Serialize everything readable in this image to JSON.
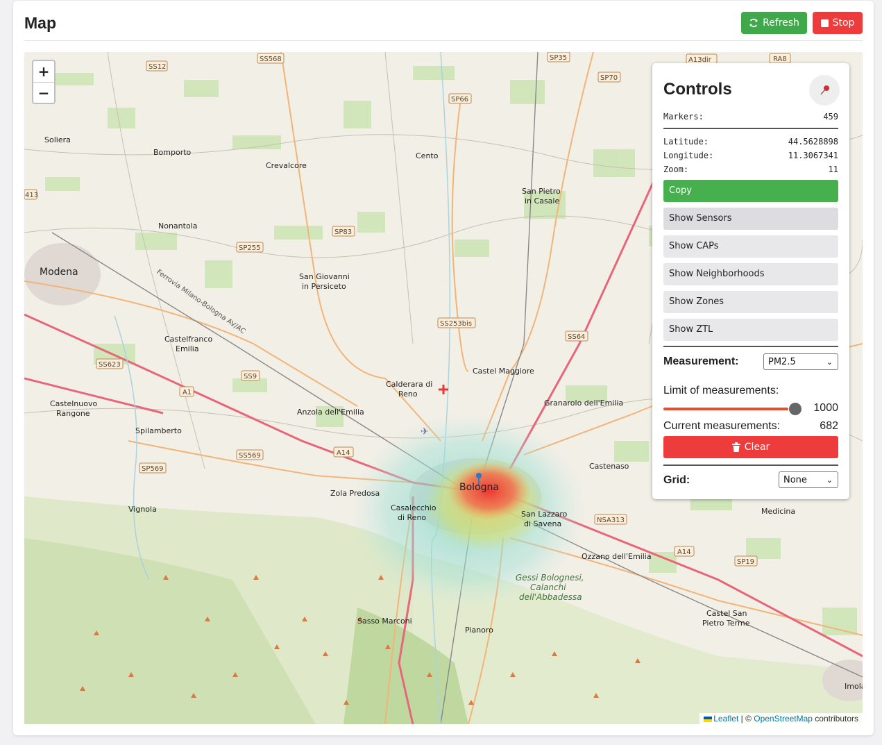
{
  "header": {
    "title": "Map",
    "refresh_label": "Refresh",
    "stop_label": "Stop"
  },
  "map": {
    "zoom_in": "+",
    "zoom_out": "−",
    "attribution": {
      "leaflet": "Leaflet",
      "separator": " | © ",
      "osm": "OpenStreetMap",
      "suffix": " contributors"
    },
    "places": {
      "soliera": "Soliera",
      "bomporto": "Bomporto",
      "crevalcore": "Crevalcore",
      "cento": "Cento",
      "san_pietro_1": "San Pietro",
      "san_pietro_2": "in Casale",
      "nonantola": "Nonantola",
      "modena": "Modena",
      "san_giovanni_1": "San Giovanni",
      "san_giovanni_2": "in Persiceto",
      "castelfranco_1": "Castelfranco",
      "castelfranco_2": "Emilia",
      "calderara_1": "Calderara di",
      "calderara_2": "Reno",
      "castel_maggiore": "Castel Maggiore",
      "granarolo": "Granarolo dell'Emilia",
      "castelnuovo_1": "Castelnuovo",
      "castelnuovo_2": "Rangone",
      "anzola": "Anzola dell'Emilia",
      "spilamberto": "Spilamberto",
      "castenaso": "Castenaso",
      "bologna": "Bologna",
      "zola": "Zola Predosa",
      "casalecchio_1": "Casalecchio",
      "casalecchio_2": "di Reno",
      "san_lazzaro_1": "San Lazzaro",
      "san_lazzaro_2": "di Savena",
      "vignola": "Vignola",
      "medicina": "Medicina",
      "ozzano": "Ozzano dell'Emilia",
      "gessi_1": "Gessi Bolognesi,",
      "gessi_2": "Calanchi",
      "gessi_3": "dell'Abbadessa",
      "sasso": "Sasso Marconi",
      "pianoro": "Pianoro",
      "castel_san_1": "Castel San",
      "castel_san_2": "Pietro Terme",
      "imola": "Imola",
      "railway": "Ferrovia Milano-Bologna AV/AC"
    },
    "roads": {
      "ss512": "SS12",
      "ss568": "SS568",
      "sp35": "SP35",
      "a13dir": "A13dir",
      "ra8": "RA8",
      "sp70": "SP70",
      "sp66": "SP66",
      "a413": "413",
      "sp83": "SP83",
      "sp255": "SP255",
      "ss253bis": "SS253bis",
      "ss64": "SS64",
      "ss623": "SS623",
      "ss9": "SS9",
      "a1": "A1",
      "a14": "A14",
      "ss569": "SS569",
      "sp569": "SP569",
      "nsa313": "NSA313",
      "a14b": "A14",
      "sp19": "SP19"
    }
  },
  "controls": {
    "title": "Controls",
    "markers_label": "Markers:",
    "markers_value": "459",
    "latitude_label": "Latitude:",
    "latitude_value": "44.5628898",
    "longitude_label": "Longitude:",
    "longitude_value": "11.3067341",
    "zoom_label": "Zoom:",
    "zoom_value": "11",
    "copy_label": "Copy",
    "layer_buttons": [
      "Show Sensors",
      "Show CAPs",
      "Show Neighborhoods",
      "Show Zones",
      "Show ZTL"
    ],
    "measurement_label": "Measurement:",
    "measurement_value": "PM2.5",
    "limit_label": "Limit of measurements:",
    "limit_value": "1000",
    "limit_fraction": 1.0,
    "current_label": "Current measurements:",
    "current_value": "682",
    "clear_label": "Clear",
    "grid_label": "Grid:",
    "grid_value": "None"
  },
  "colors": {
    "refresh": "#3fa84a",
    "stop": "#ee3b3b",
    "copy": "#47b04e",
    "slider": "#e5502c"
  }
}
